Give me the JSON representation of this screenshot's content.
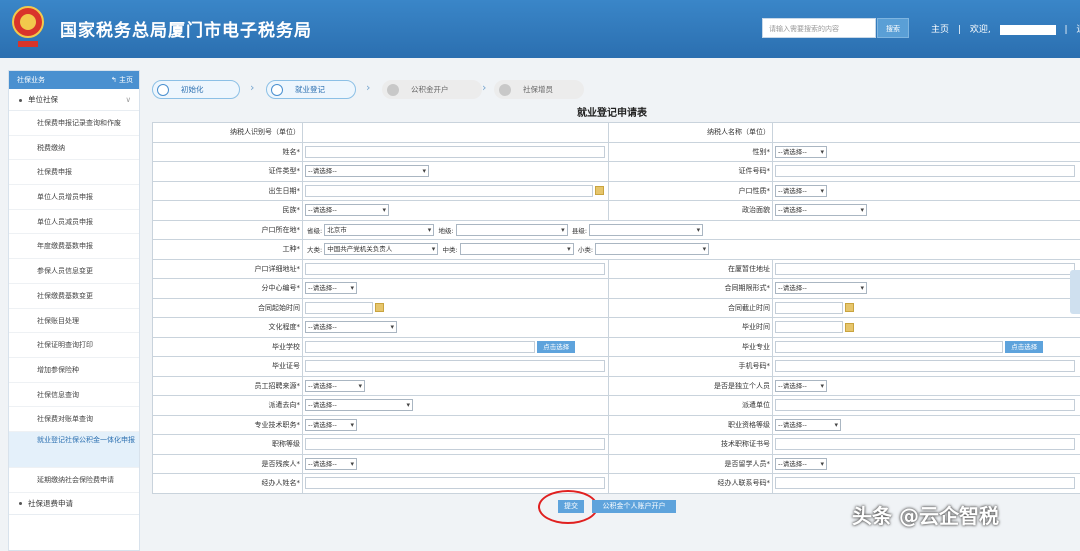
{
  "header": {
    "title": "国家税务总局厦门市电子税务局",
    "search_placeholder": "请输入需要搜索的内容",
    "search_label": "搜索",
    "nav_home": "主页",
    "nav_welcome": "欢迎,",
    "nav_logout": "退出",
    "nav_sep": "|"
  },
  "sidebar": {
    "header": "社保业务",
    "home": "主页",
    "group1": "单位社保",
    "group1_chev": "∨",
    "items": [
      "社保费申报记录查询和作废",
      "税费缴纳",
      "社保费申报",
      "单位人员增员申报",
      "单位人员减员申报",
      "年度缴费基数申报",
      "参保人员信息变更",
      "社保缴费基数变更",
      "社保账目处理",
      "社保证明查询打印",
      "增加参保险种",
      "社保信息查询",
      "社保费对账单查询",
      "就业登记社保公积金一体化申报",
      "延期缴纳社会保险费申请"
    ],
    "group2": "社保退费申请"
  },
  "steps": [
    "初始化",
    "就业登记",
    "公积金开户",
    "社保增员"
  ],
  "step_arrow": "›",
  "form": {
    "title": "就业登记申请表",
    "select_default": "--请选择--",
    "labels": {
      "taxpayer_id": "纳税人识别号（单位）",
      "taxpayer_name": "纳税人名称（单位）",
      "name": "姓名*",
      "gender": "性别*",
      "id_type": "证件类型*",
      "id_number": "证件号码*",
      "birth": "出生日期*",
      "hukou_type": "户口性质*",
      "ethnic": "民族*",
      "political": "政治面貌",
      "hukou_loc": "户口所在地*",
      "province": "省级:",
      "city": "地级:",
      "county": "县级:",
      "job_type": "工种*",
      "big_cat": "大类:",
      "mid_cat": "中类:",
      "small_cat": "小类:",
      "hukou_addr": "户口详细地址*",
      "residence": "在厦暂住地址",
      "center": "分中心编号*",
      "contract_form": "合同期限形式*",
      "contract_start": "合同起始时间",
      "contract_end": "合同截止时间",
      "education": "文化程度*",
      "grad_time": "毕业时间",
      "school": "毕业学校",
      "major": "毕业专业",
      "cert": "毕业证号",
      "phone": "手机号码*",
      "source": "员工招聘来源*",
      "flex": "是否是独立个人员",
      "dispatch": "派遣去向*",
      "dispatch_unit": "派遣单位",
      "tech_post": "专业技术职务*",
      "qual_level": "职业资格等级",
      "title_level": "职称等级",
      "tech_cert": "技术职称证书号",
      "disabled": "是否残疾人*",
      "overseas": "是否留学人员*",
      "agent_name": "经办人姓名*",
      "agent_phone": "经办人联系号码*"
    },
    "values": {
      "province": "北京市",
      "big_cat": "中国共产党机关负责人"
    },
    "pick_label": "点击选择"
  },
  "actions": {
    "submit": "提交",
    "open_account": "公积金个人账户开户"
  },
  "watermark": "头条 @云企智税"
}
